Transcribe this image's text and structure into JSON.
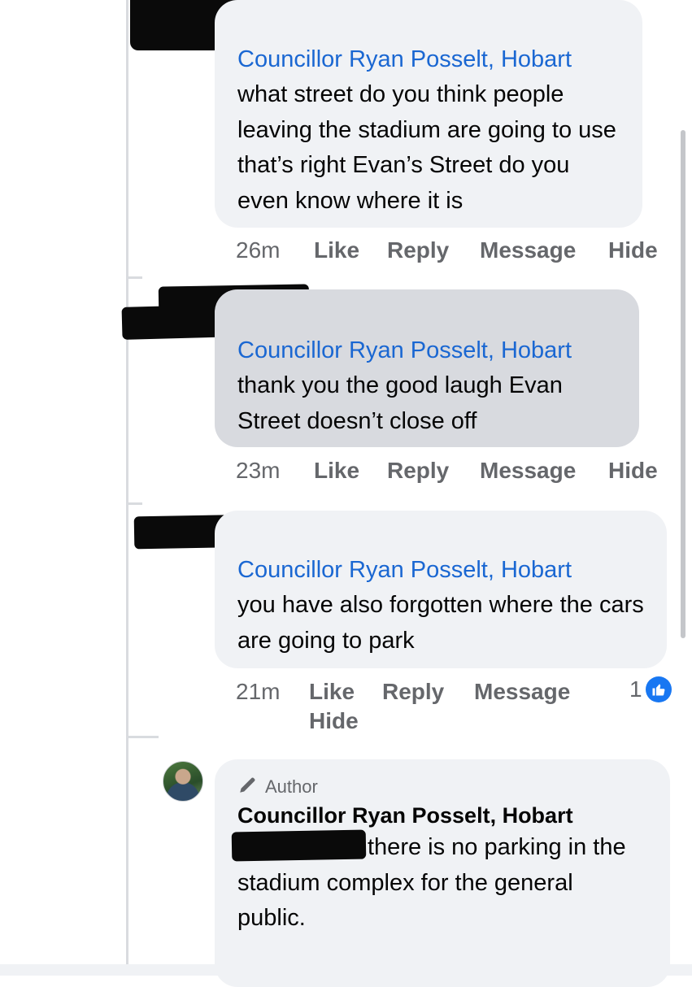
{
  "comments": [
    {
      "mention": "Councillor Ryan Posselt, Hobart",
      "text": "what street do you think people leaving the stadium are going to use that’s right Evan’s Street do you even know where it is",
      "time": "26m",
      "actions": [
        "Like",
        "Reply",
        "Message",
        "Hide"
      ]
    },
    {
      "mention": "Councillor Ryan Posselt, Hobart",
      "text": "thank you the good laugh Evan Street doesn’t close off",
      "time": "23m",
      "actions": [
        "Like",
        "Reply",
        "Message",
        "Hide"
      ]
    },
    {
      "mention": "Councillor Ryan Posselt, Hobart",
      "text": "you have also forgotten where the cars are going to park",
      "time": "21m",
      "actions": [
        "Like",
        "Reply",
        "Message",
        "Hide"
      ],
      "reaction_count": "1",
      "reaction_icon": "thumbs-up-icon"
    }
  ],
  "author_reply": {
    "badge": "Author",
    "badge_icon": "pencil-icon",
    "name": "Councillor Ryan Posselt, Hobart",
    "text": "there is no parking in the stadium complex for the general public."
  },
  "colors": {
    "mention": "#1a67d2",
    "bubble": "#f0f2f5",
    "bubble_highlight": "#d8dadf",
    "meta": "#65676b",
    "like_blue": "#1877f2"
  }
}
